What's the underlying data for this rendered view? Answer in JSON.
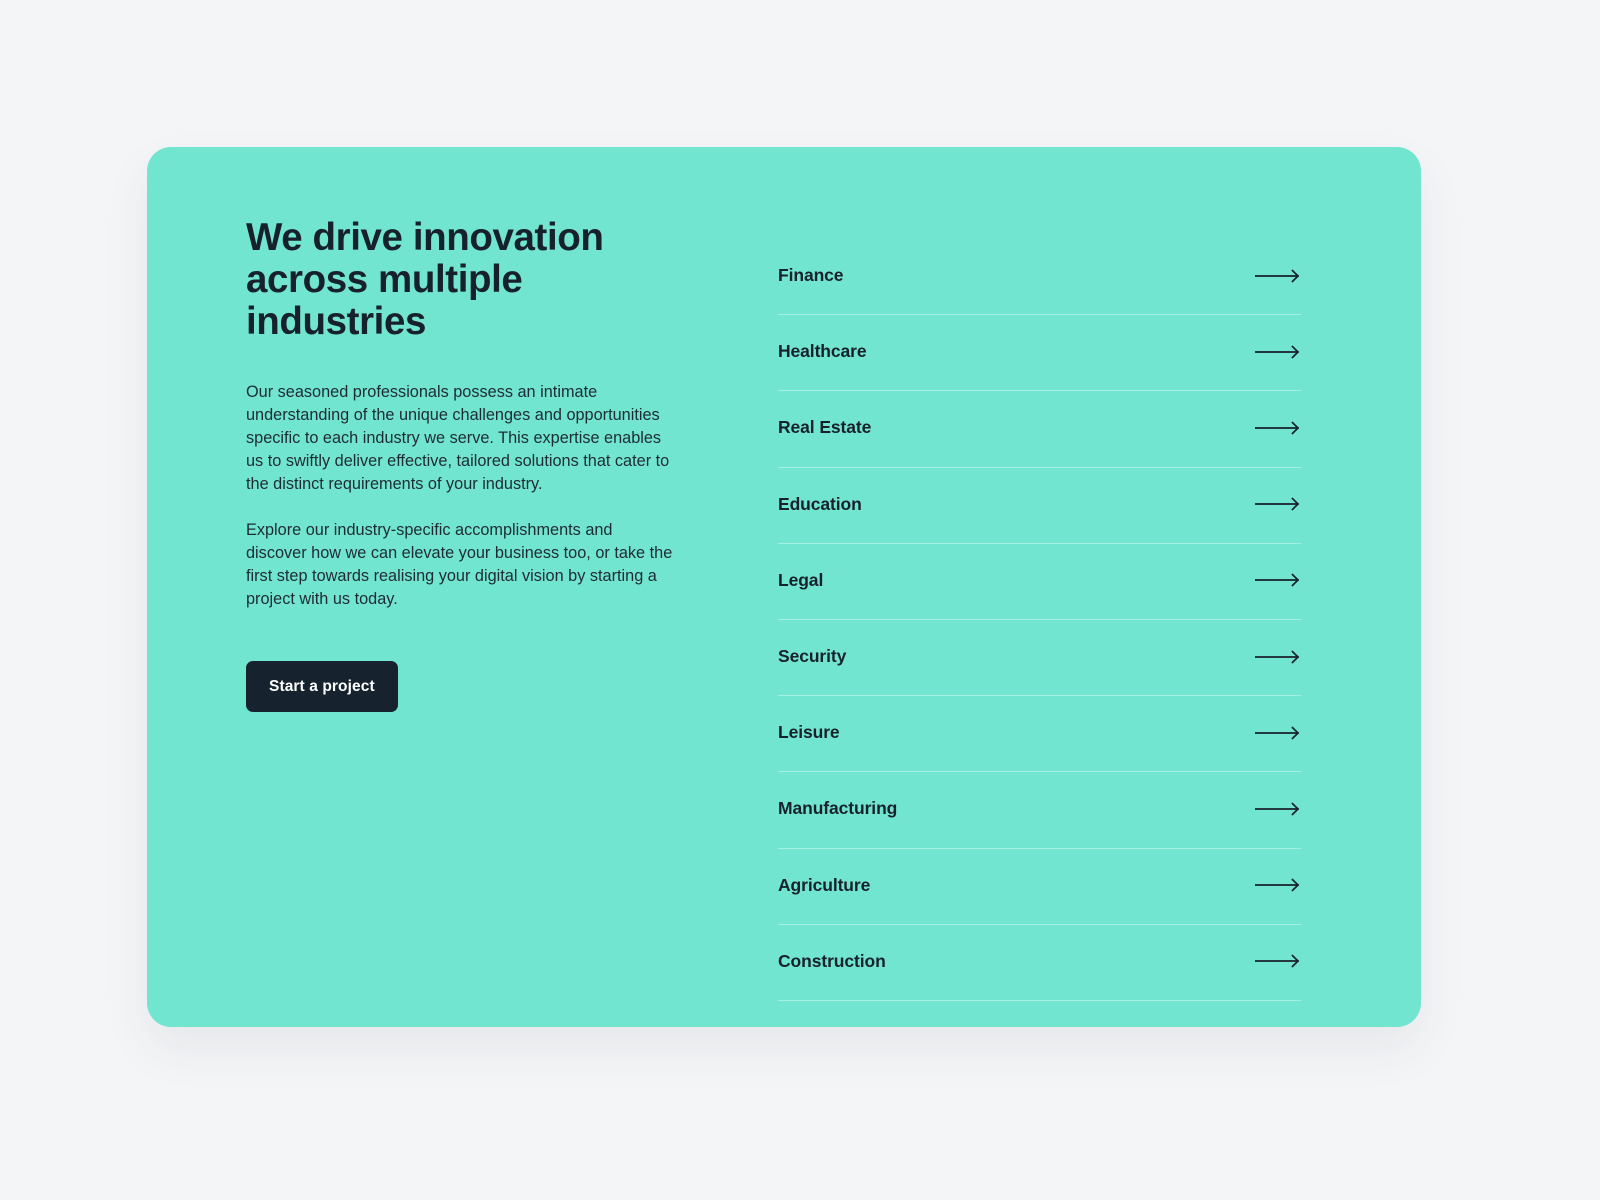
{
  "theme": {
    "page_background": "#f4f5f7",
    "card_background": "#72e5d1",
    "text_color": "#17212b",
    "button_background": "#16232e",
    "button_text_color": "#ffffff",
    "divider_color": "rgba(255,255,255,0.38)"
  },
  "hero": {
    "headline_line1": "We drive innovation",
    "headline_line2": "across multiple industries",
    "paragraph1": "Our seasoned professionals possess an intimate understanding of the unique challenges and opportunities specific to each industry we serve. This expertise enables us to swiftly deliver effective, tailored solutions that cater to the distinct requirements of your industry.",
    "paragraph2": "Explore our industry-specific accomplishments and discover how we can elevate your business too, or take the first step towards realising your digital vision by starting a project with us today.",
    "cta_label": "Start a project"
  },
  "industries": {
    "arrow_icon": "arrow-right-icon",
    "items": [
      {
        "label": "Finance"
      },
      {
        "label": "Healthcare"
      },
      {
        "label": "Real Estate"
      },
      {
        "label": "Education"
      },
      {
        "label": "Legal"
      },
      {
        "label": "Security"
      },
      {
        "label": "Leisure"
      },
      {
        "label": "Manufacturing"
      },
      {
        "label": "Agriculture"
      },
      {
        "label": "Construction"
      }
    ]
  }
}
